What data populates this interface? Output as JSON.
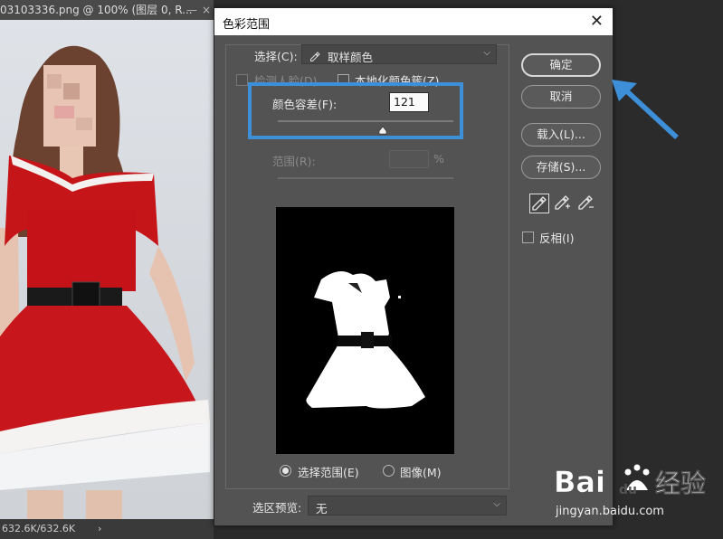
{
  "doc": {
    "tab_title": "03103336.png @ 100% (图层 0, R...",
    "status_text": "632.6K/632.6K",
    "status_arrow": "›",
    "minimize": "—",
    "close": "×"
  },
  "dialog": {
    "title": "色彩范围",
    "close_glyph": "✕",
    "select_label": "选择(C):",
    "select_value": "取样颜色",
    "detect_faces_label": "检测人脸(D)",
    "localized_label": "本地化颜色簇(Z)",
    "fuzziness_label": "颜色容差(F):",
    "fuzziness_value": "121",
    "fuzziness_fraction": 0.6,
    "range_label": "范围(R):",
    "range_unit": "%",
    "radio_selection_label": "选择范围(E)",
    "radio_image_label": "图像(M)",
    "preview_label": "选区预览:",
    "preview_value": "无",
    "buttons": {
      "ok": "确定",
      "cancel": "取消",
      "load": "载入(L)...",
      "save": "存储(S)..."
    },
    "invert_label": "反相(I)"
  },
  "watermark": {
    "brand": "Bai",
    "brand2": "经验",
    "url": "jingyan.baidu.com"
  },
  "colors": {
    "highlight": "#3d8fd8",
    "arrow": "#3d8fd8",
    "dialog_bg": "#535353"
  }
}
